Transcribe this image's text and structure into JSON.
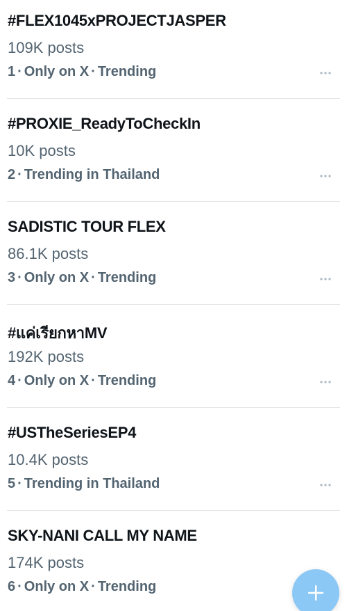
{
  "trends": [
    {
      "rank": "1",
      "name": "#FLEX1045xPROJECTJASPER",
      "posts": "109K posts",
      "context": "Only on X",
      "category": "Trending"
    },
    {
      "rank": "2",
      "name": "#PROXIE_ReadyToCheckIn",
      "posts": "10K posts",
      "context": "Trending in Thailand",
      "category": ""
    },
    {
      "rank": "3",
      "name": "SADISTIC TOUR FLEX",
      "posts": "86.1K posts",
      "context": "Only on X",
      "category": "Trending"
    },
    {
      "rank": "4",
      "name": "#แค่เรียกหาMV",
      "posts": "192K posts",
      "context": "Only on X",
      "category": "Trending"
    },
    {
      "rank": "5",
      "name": "#USTheSeriesEP4",
      "posts": "10.4K posts",
      "context": "Trending in Thailand",
      "category": ""
    },
    {
      "rank": "6",
      "name": "SKY-NANI CALL MY NAME",
      "posts": "174K posts",
      "context": "Only on X",
      "category": "Trending"
    }
  ],
  "separator": "·",
  "icons": {
    "more": "more-horizontal-icon",
    "compose": "plus-icon"
  },
  "colors": {
    "primary_text": "#0f1419",
    "secondary_text": "#536471",
    "divider": "#e3e6e8",
    "fab": "#8cc8f5",
    "more_dots": "#aab8c2"
  }
}
